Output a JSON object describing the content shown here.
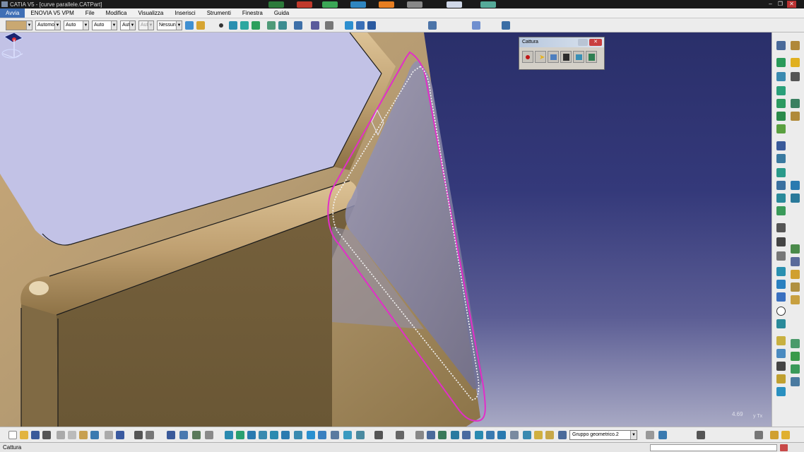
{
  "window": {
    "title": "CATIA V5 - [curve parallele.CATPart]"
  },
  "menu": {
    "items": [
      "Avvia",
      "ENOVIA V5 VPM",
      "File",
      "Modifica",
      "Visualizza",
      "Inserisci",
      "Strumenti",
      "Finestra",
      "Guida"
    ],
    "active": "Avvia"
  },
  "graphic_properties": {
    "color_value": "",
    "transparency": "Automo",
    "line_thickness": "Auto",
    "line_type": "Auto",
    "point_type": "Aut",
    "point_type_disabled": "Aut",
    "layer": "Nessun"
  },
  "capture_panel": {
    "title": "Cattura",
    "tools": [
      "record-icon",
      "select-icon",
      "capture-icon",
      "album-icon",
      "image-icon",
      "options-icon"
    ]
  },
  "viewport": {
    "zoom_readout": "4.69",
    "mini_axis_label": "y Tx"
  },
  "bottom_toolbar": {
    "current_geometric_set": "Gruppo geometrico.2"
  },
  "status": {
    "text": "Cattura"
  },
  "colors": {
    "part_tan": "#b59b72",
    "part_shadow": "#6e5c3b",
    "flat_face": "#c2c2e6",
    "highlight_magenta": "#e22ec8",
    "background_top": "#2a2f6a",
    "background_bottom": "#a8a9c4",
    "menu_active": "#3f6fb5"
  }
}
